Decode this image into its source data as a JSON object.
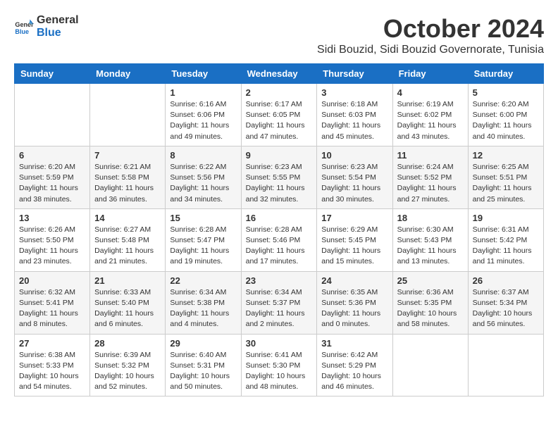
{
  "logo": {
    "text1": "General",
    "text2": "Blue"
  },
  "title": "October 2024",
  "location": "Sidi Bouzid, Sidi Bouzid Governorate, Tunisia",
  "days_of_week": [
    "Sunday",
    "Monday",
    "Tuesday",
    "Wednesday",
    "Thursday",
    "Friday",
    "Saturday"
  ],
  "weeks": [
    [
      {
        "day": "",
        "detail": ""
      },
      {
        "day": "",
        "detail": ""
      },
      {
        "day": "1",
        "detail": "Sunrise: 6:16 AM\nSunset: 6:06 PM\nDaylight: 11 hours and 49 minutes."
      },
      {
        "day": "2",
        "detail": "Sunrise: 6:17 AM\nSunset: 6:05 PM\nDaylight: 11 hours and 47 minutes."
      },
      {
        "day": "3",
        "detail": "Sunrise: 6:18 AM\nSunset: 6:03 PM\nDaylight: 11 hours and 45 minutes."
      },
      {
        "day": "4",
        "detail": "Sunrise: 6:19 AM\nSunset: 6:02 PM\nDaylight: 11 hours and 43 minutes."
      },
      {
        "day": "5",
        "detail": "Sunrise: 6:20 AM\nSunset: 6:00 PM\nDaylight: 11 hours and 40 minutes."
      }
    ],
    [
      {
        "day": "6",
        "detail": "Sunrise: 6:20 AM\nSunset: 5:59 PM\nDaylight: 11 hours and 38 minutes."
      },
      {
        "day": "7",
        "detail": "Sunrise: 6:21 AM\nSunset: 5:58 PM\nDaylight: 11 hours and 36 minutes."
      },
      {
        "day": "8",
        "detail": "Sunrise: 6:22 AM\nSunset: 5:56 PM\nDaylight: 11 hours and 34 minutes."
      },
      {
        "day": "9",
        "detail": "Sunrise: 6:23 AM\nSunset: 5:55 PM\nDaylight: 11 hours and 32 minutes."
      },
      {
        "day": "10",
        "detail": "Sunrise: 6:23 AM\nSunset: 5:54 PM\nDaylight: 11 hours and 30 minutes."
      },
      {
        "day": "11",
        "detail": "Sunrise: 6:24 AM\nSunset: 5:52 PM\nDaylight: 11 hours and 27 minutes."
      },
      {
        "day": "12",
        "detail": "Sunrise: 6:25 AM\nSunset: 5:51 PM\nDaylight: 11 hours and 25 minutes."
      }
    ],
    [
      {
        "day": "13",
        "detail": "Sunrise: 6:26 AM\nSunset: 5:50 PM\nDaylight: 11 hours and 23 minutes."
      },
      {
        "day": "14",
        "detail": "Sunrise: 6:27 AM\nSunset: 5:48 PM\nDaylight: 11 hours and 21 minutes."
      },
      {
        "day": "15",
        "detail": "Sunrise: 6:28 AM\nSunset: 5:47 PM\nDaylight: 11 hours and 19 minutes."
      },
      {
        "day": "16",
        "detail": "Sunrise: 6:28 AM\nSunset: 5:46 PM\nDaylight: 11 hours and 17 minutes."
      },
      {
        "day": "17",
        "detail": "Sunrise: 6:29 AM\nSunset: 5:45 PM\nDaylight: 11 hours and 15 minutes."
      },
      {
        "day": "18",
        "detail": "Sunrise: 6:30 AM\nSunset: 5:43 PM\nDaylight: 11 hours and 13 minutes."
      },
      {
        "day": "19",
        "detail": "Sunrise: 6:31 AM\nSunset: 5:42 PM\nDaylight: 11 hours and 11 minutes."
      }
    ],
    [
      {
        "day": "20",
        "detail": "Sunrise: 6:32 AM\nSunset: 5:41 PM\nDaylight: 11 hours and 8 minutes."
      },
      {
        "day": "21",
        "detail": "Sunrise: 6:33 AM\nSunset: 5:40 PM\nDaylight: 11 hours and 6 minutes."
      },
      {
        "day": "22",
        "detail": "Sunrise: 6:34 AM\nSunset: 5:38 PM\nDaylight: 11 hours and 4 minutes."
      },
      {
        "day": "23",
        "detail": "Sunrise: 6:34 AM\nSunset: 5:37 PM\nDaylight: 11 hours and 2 minutes."
      },
      {
        "day": "24",
        "detail": "Sunrise: 6:35 AM\nSunset: 5:36 PM\nDaylight: 11 hours and 0 minutes."
      },
      {
        "day": "25",
        "detail": "Sunrise: 6:36 AM\nSunset: 5:35 PM\nDaylight: 10 hours and 58 minutes."
      },
      {
        "day": "26",
        "detail": "Sunrise: 6:37 AM\nSunset: 5:34 PM\nDaylight: 10 hours and 56 minutes."
      }
    ],
    [
      {
        "day": "27",
        "detail": "Sunrise: 6:38 AM\nSunset: 5:33 PM\nDaylight: 10 hours and 54 minutes."
      },
      {
        "day": "28",
        "detail": "Sunrise: 6:39 AM\nSunset: 5:32 PM\nDaylight: 10 hours and 52 minutes."
      },
      {
        "day": "29",
        "detail": "Sunrise: 6:40 AM\nSunset: 5:31 PM\nDaylight: 10 hours and 50 minutes."
      },
      {
        "day": "30",
        "detail": "Sunrise: 6:41 AM\nSunset: 5:30 PM\nDaylight: 10 hours and 48 minutes."
      },
      {
        "day": "31",
        "detail": "Sunrise: 6:42 AM\nSunset: 5:29 PM\nDaylight: 10 hours and 46 minutes."
      },
      {
        "day": "",
        "detail": ""
      },
      {
        "day": "",
        "detail": ""
      }
    ]
  ]
}
